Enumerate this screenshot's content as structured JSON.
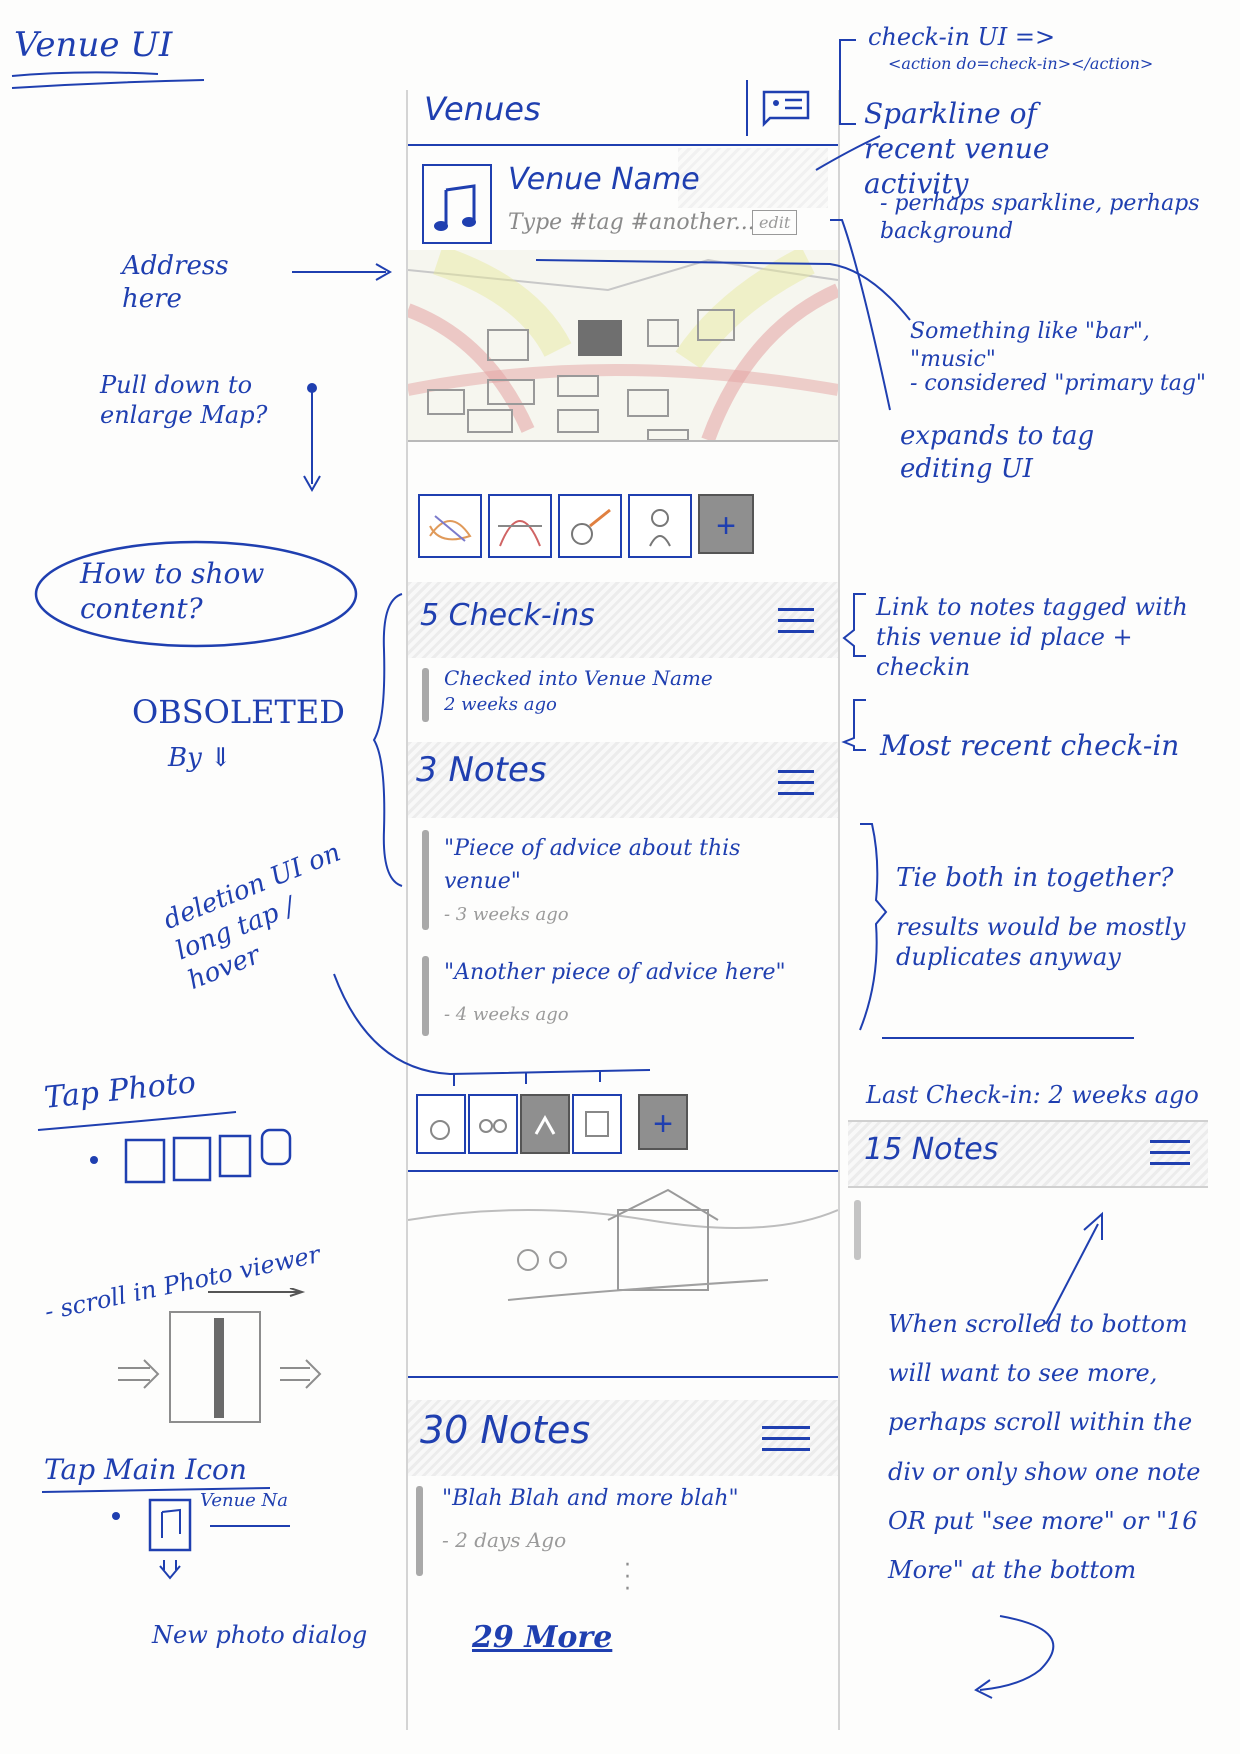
{
  "page_title": "Venue UI",
  "app_header": {
    "title": "Venues"
  },
  "venue_card": {
    "name": "Venue Name",
    "tags": "Type #tag #another...",
    "edit_label": "edit",
    "icon": "music-note-icon"
  },
  "add_photo_label": "+",
  "checkins_section": {
    "title": "5 Check-ins",
    "latest_text": "Checked into Venue Name",
    "latest_time": "2 weeks ago"
  },
  "notes_section": {
    "title": "3 Notes",
    "items": [
      {
        "text": "\"Piece of advice about this venue\"",
        "time": "- 3 weeks ago"
      },
      {
        "text": "\"Another piece of advice here\"",
        "time": "- 4 weeks ago"
      }
    ]
  },
  "bottom_notes": {
    "title": "30 Notes",
    "item_text": "\"Blah Blah and more blah\"",
    "item_time": "- 2 days Ago",
    "more_link": "29 More"
  },
  "side_widget": {
    "last_checkin": "Last Check-in: 2 weeks ago",
    "notes_title": "15 Notes"
  },
  "annotations": {
    "checkin_ui": "check-in UI =>",
    "checkin_ui_code": "<action do=check-in></action>",
    "sparkline": "Sparkline of recent venue activity",
    "sparkline_note": "- perhaps sparkline, perhaps background",
    "primary_tag": "Something like \"bar\", \"music\"",
    "primary_tag_note": "- considered \"primary tag\"",
    "expands": "expands to tag editing UI",
    "address": "Address here",
    "pull_down": "Pull down to enlarge Map?",
    "how_show": "How to show content?",
    "obsoleted": "OBSOLETED",
    "obsoleted_by": "By ⇓",
    "link_notes": "Link to notes tagged with this venue id place + checkin",
    "most_recent": "Most recent check-in",
    "tie_both": "Tie both in together?",
    "tie_both_note": "results would be mostly duplicates anyway",
    "deletion": "deletion UI on long tap / hover",
    "tap_photo": "Tap Photo",
    "scroll_viewer": "- scroll in Photo viewer",
    "tap_main_icon": "Tap Main Icon",
    "venue_mini": "Venue Na",
    "new_photo": "New photo dialog",
    "when_scrolled": "When scrolled to bottom will want to see more, perhaps scroll within the div or only show one note OR put \"see more\" or \"16 More\" at the bottom"
  },
  "colors": {
    "ink": "#1f3fb0",
    "pencil": "#8d8d8d"
  }
}
